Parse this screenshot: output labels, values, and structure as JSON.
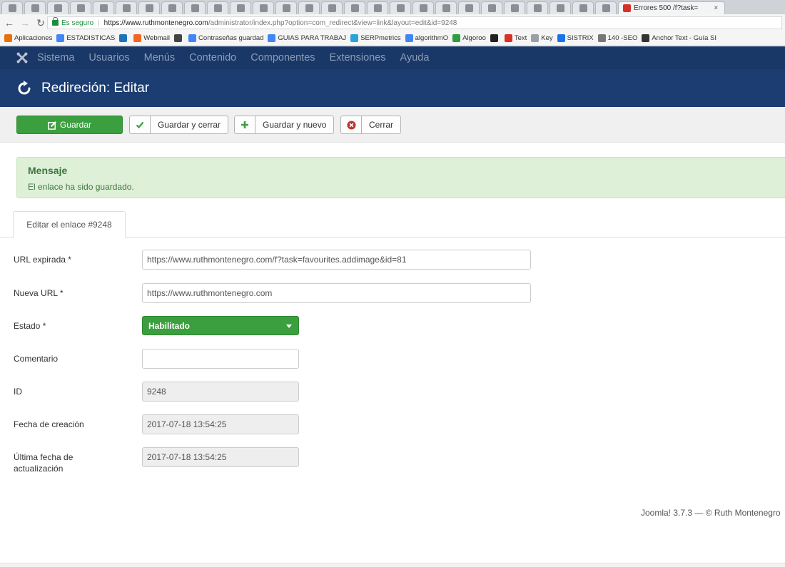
{
  "browser": {
    "tab_count": 28,
    "last_tab_title": "Errores 500 /f?task=",
    "last_tab_close": "×",
    "secure_label": "Es seguro",
    "url_host": "https://www.ruthmontenegro.com",
    "url_path": "/administrator/index.php?option=com_redirect&view=link&layout=edit&id=9248",
    "bookmarks": [
      {
        "label": "Aplicaciones",
        "icon": "apps-grid-icon",
        "color": "#e8710a"
      },
      {
        "label": "ESTADISTICAS",
        "icon": "google-icon",
        "color": "#4285f4"
      },
      {
        "label": "",
        "icon": "m-icon",
        "color": "#1e73be"
      },
      {
        "label": "Webmail",
        "icon": "cpanel-icon",
        "color": "#f26522"
      },
      {
        "label": "",
        "icon": "mic-icon",
        "color": "#444444"
      },
      {
        "label": "Contraseñas guardad",
        "icon": "google-icon",
        "color": "#4285f4"
      },
      {
        "label": "GUIAS PARA TRABAJ",
        "icon": "doc-icon",
        "color": "#4285f4"
      },
      {
        "label": "SERPmetrics",
        "icon": "serp-icon",
        "color": "#2aa4d8"
      },
      {
        "label": "algorithmO",
        "icon": "google-icon",
        "color": "#4285f4"
      },
      {
        "label": "Algoroo",
        "icon": "play-icon",
        "color": "#2e9e3f"
      },
      {
        "label": "",
        "icon": "dot-icon",
        "color": "#222222"
      },
      {
        "label": "Text",
        "icon": "bars-icon",
        "color": "#d93025"
      },
      {
        "label": "Key",
        "icon": "page-icon",
        "color": "#9aa0a6"
      },
      {
        "label": "SISTRIX",
        "icon": "search-icon",
        "color": "#1a73e8"
      },
      {
        "label": "140 -SEO",
        "icon": "list-icon",
        "color": "#777777"
      },
      {
        "label": "Anchor Text - Guía SI",
        "icon": "b30-icon",
        "color": "#333333"
      }
    ]
  },
  "topnav": {
    "items": [
      "Sistema",
      "Usuarios",
      "Menús",
      "Contenido",
      "Componentes",
      "Extensiones",
      "Ayuda"
    ]
  },
  "header": {
    "title": "Redireción: Editar"
  },
  "toolbar": {
    "save_label": "Guardar",
    "save_close_label": "Guardar y cerrar",
    "save_new_label": "Guardar y nuevo",
    "close_label": "Cerrar"
  },
  "message": {
    "heading": "Mensaje",
    "text": "El enlace ha sido guardado."
  },
  "tabs": {
    "active": "Editar el enlace #9248"
  },
  "form": {
    "expired_url_label": "URL expirada *",
    "expired_url_value": "https://www.ruthmontenegro.com/f?task=favourites.addimage&id=81",
    "new_url_label": "Nueva URL *",
    "new_url_value": "https://www.ruthmontenegro.com",
    "status_label": "Estado *",
    "status_value": "Habilitado",
    "comment_label": "Comentario",
    "comment_value": "",
    "id_label": "ID",
    "id_value": "9248",
    "created_label": "Fecha de creación",
    "created_value": "2017-07-18 13:54:25",
    "updated_label_1": "Última fecha de",
    "updated_label_2": "actualización",
    "updated_value": "2017-07-18 13:54:25"
  },
  "footer": {
    "text": "Joomla! 3.7.3  —  © Ruth Montenegro"
  },
  "colors": {
    "topnav_bg": "#1a3867",
    "header_bg": "#1c3d71",
    "success_green": "#3c9f3f",
    "alert_bg": "#dff0d8",
    "alert_text": "#3c763d"
  }
}
